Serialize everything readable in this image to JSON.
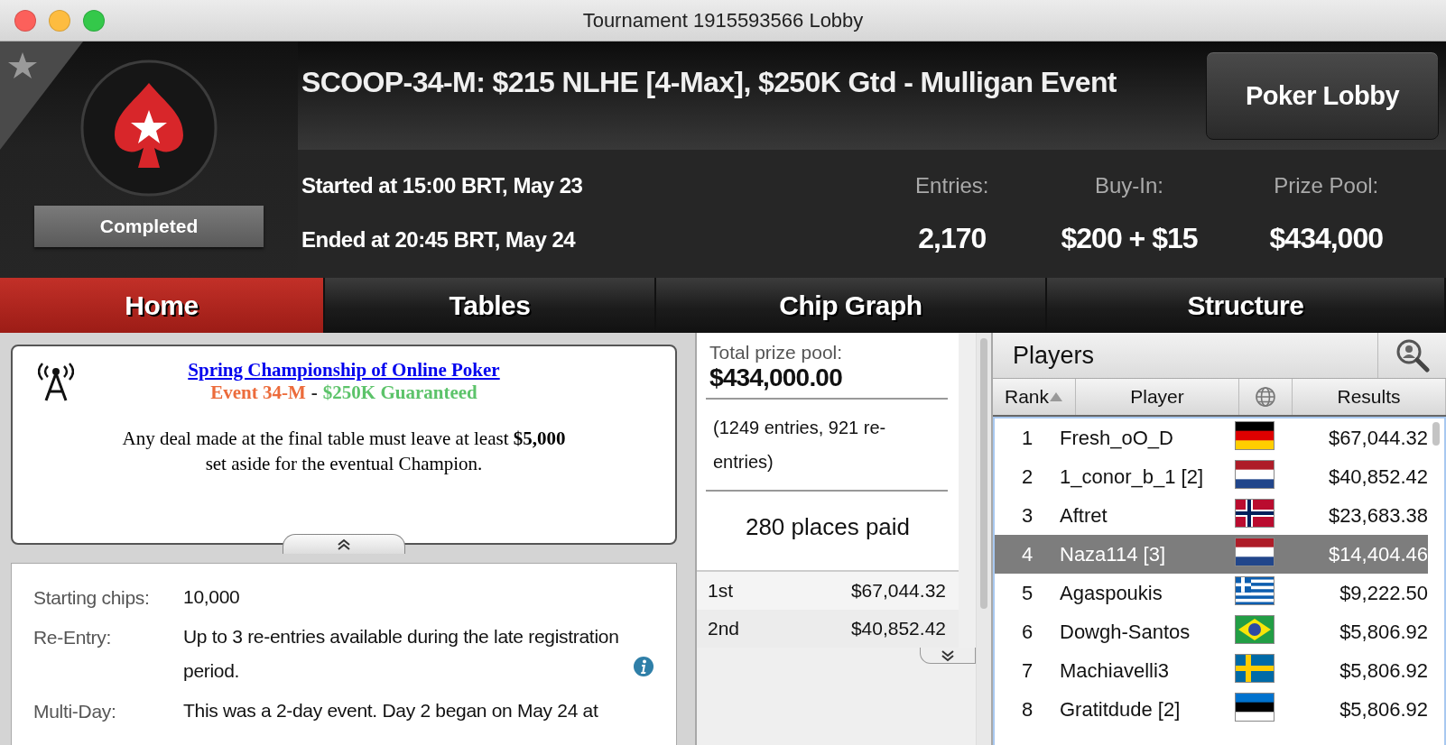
{
  "window": {
    "title": "Tournament 1915593566 Lobby"
  },
  "header": {
    "title": "SCOOP-34-M: $215 NLHE [4-Max], $250K Gtd - Mulligan Event",
    "status": "Completed",
    "started": "Started at 15:00 BRT, May 23",
    "ended": "Ended at 20:45 BRT, May 24",
    "lobby_button": "Poker Lobby",
    "stats": [
      {
        "label": "Entries:",
        "value": "2,170"
      },
      {
        "label": "Buy-In:",
        "value": "$200 + $15"
      },
      {
        "label": "Prize Pool:",
        "value": "$434,000"
      }
    ]
  },
  "tabs": [
    {
      "label": "Home",
      "selected": true
    },
    {
      "label": "Tables",
      "selected": false
    },
    {
      "label": "Chip Graph",
      "selected": false
    },
    {
      "label": "Structure",
      "selected": false
    }
  ],
  "news": {
    "link": "Spring Championship of Online Poker",
    "event": "Event 34-M",
    "separator": "-",
    "guarantee": "$250K Guaranteed",
    "message": "Any deal made at the final table must leave at least **$5,000** set aside for the eventual Champion."
  },
  "details": [
    {
      "label": "Starting chips:",
      "value": "10,000",
      "info": false
    },
    {
      "label": "Re-Entry:",
      "value": "Up to 3 re-entries available during the late registration period.",
      "info": true
    },
    {
      "label": "Multi-Day:",
      "value": "This was a 2-day event. Day 2 began on May 24 at",
      "info": false
    }
  ],
  "prizes": {
    "label": "Total prize pool:",
    "total": "$434,000.00",
    "entries": "(1249 entries, 921 re-entries)",
    "places": "280 places paid",
    "payouts": [
      {
        "place": "1st",
        "amount": "$67,044.32"
      },
      {
        "place": "2nd",
        "amount": "$40,852.42"
      }
    ]
  },
  "players": {
    "title": "Players",
    "columns": [
      {
        "kind": "text",
        "label": "Rank",
        "sorted": true
      },
      {
        "kind": "text",
        "label": "Player",
        "sorted": false
      },
      {
        "kind": "globe",
        "sorted": false
      },
      {
        "kind": "text",
        "label": "Results",
        "sorted": false
      }
    ],
    "rows": [
      {
        "rank": "1",
        "name": "Fresh_oO_D",
        "kind": "de",
        "result": "$67,044.32",
        "selected": false
      },
      {
        "rank": "2",
        "name": "1_conor_b_1 [2]",
        "kind": "nl",
        "result": "$40,852.42",
        "selected": false
      },
      {
        "rank": "3",
        "name": "Aftret",
        "kind": "no",
        "result": "$23,683.38",
        "selected": false
      },
      {
        "rank": "4",
        "name": "Naza114 [3]",
        "kind": "nl",
        "result": "$14,404.46",
        "selected": true
      },
      {
        "rank": "5",
        "name": "Agaspoukis",
        "kind": "gr",
        "result": "$9,222.50",
        "selected": false
      },
      {
        "rank": "6",
        "name": "Dowgh-Santos",
        "kind": "br",
        "result": "$5,806.92",
        "selected": false
      },
      {
        "rank": "7",
        "name": "Machiavelli3",
        "kind": "se",
        "result": "$5,806.92",
        "selected": false
      },
      {
        "rank": "8",
        "name": "Gratitdude [2]",
        "kind": "ee",
        "result": "$5,806.92",
        "selected": false
      }
    ]
  }
}
